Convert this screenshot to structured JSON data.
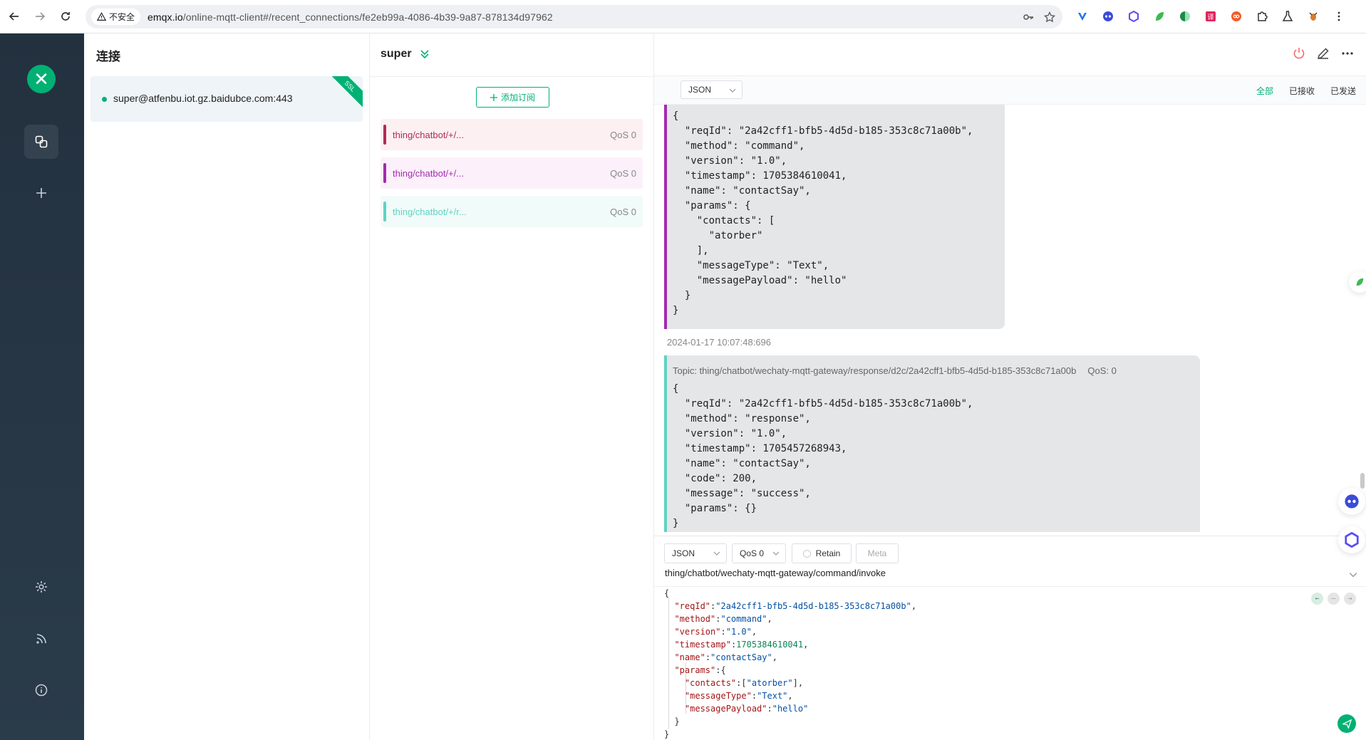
{
  "browser": {
    "insecure_label": "不安全",
    "url_host": "emqx.io",
    "url_path": "/online-mqtt-client#/recent_connections/fe2eb99a-4086-4b39-9a87-878134d97962",
    "extension_icons": [
      "vee-icon",
      "bot-face-icon",
      "hex-icon",
      "leaf-icon",
      "split-circle-icon",
      "translate-icon",
      "infinity-icon",
      "puzzle-icon",
      "flask-icon",
      "bug-icon",
      "menu-dots-icon"
    ]
  },
  "sidebar": {
    "logo_glyph": "✕",
    "items": [
      "connections-icon",
      "add-icon",
      "settings-icon",
      "feed-icon",
      "info-icon"
    ]
  },
  "connections": {
    "title": "连接",
    "items": [
      {
        "name": "super@atfenbu.iot.gz.baidubce.com:443",
        "badge": "SSL",
        "status_color": "#00b173"
      }
    ]
  },
  "subscriptions": {
    "connection_name": "super",
    "add_button": "添加订阅",
    "items": [
      {
        "topic": "thing/chatbot/+/...",
        "qos": "QoS 0",
        "color": "#b02b55",
        "bg": "#fcf0f3"
      },
      {
        "topic": "thing/chatbot/+/...",
        "qos": "QoS 0",
        "color": "#a32bb0",
        "bg": "#fcf0fa"
      },
      {
        "topic": "thing/chatbot/+/r...",
        "qos": "QoS 0",
        "color": "#5fd3c3",
        "bg": "#f1fbf9"
      }
    ]
  },
  "messages": {
    "format_select": "JSON",
    "tabs": [
      "全部",
      "已接收",
      "已发送"
    ],
    "active_tab": "全部",
    "list": [
      {
        "direction": "received",
        "border_color": "#a32bb0",
        "topic": "",
        "qos": "",
        "payload": "{\n  \"reqId\": \"2a42cff1-bfb5-4d5d-b185-353c8c71a00b\",\n  \"method\": \"command\",\n  \"version\": \"1.0\",\n  \"timestamp\": 1705384610041,\n  \"name\": \"contactSay\",\n  \"params\": {\n    \"contacts\": [\n      \"atorber\"\n    ],\n    \"messageType\": \"Text\",\n    \"messagePayload\": \"hello\"\n  }\n}",
        "time": "2024-01-17 10:07:48:696"
      },
      {
        "direction": "received",
        "border_color": "#5fd3c3",
        "topic": "Topic: thing/chatbot/wechaty-mqtt-gateway/response/d2c/2a42cff1-bfb5-4d5d-b185-353c8c71a00b",
        "qos": "QoS: 0",
        "payload": "{\n  \"reqId\": \"2a42cff1-bfb5-4d5d-b185-353c8c71a00b\",\n  \"method\": \"response\",\n  \"version\": \"1.0\",\n  \"timestamp\": 1705457268943,\n  \"name\": \"contactSay\",\n  \"code\": 200,\n  \"message\": \"success\",\n  \"params\": {}\n}",
        "time": ""
      }
    ]
  },
  "publish": {
    "format": "JSON",
    "qos": "QoS 0",
    "retain_label": "Retain",
    "meta_label": "Meta",
    "topic": "thing/chatbot/wechaty-mqtt-gateway/command/invoke",
    "payload_lines": [
      "{",
      "  \"reqId\":\"2a42cff1-bfb5-4d5d-b185-353c8c71a00b\",",
      "  \"method\":\"command\",",
      "  \"version\":\"1.0\",",
      "  \"timestamp\":1705384610041,",
      "  \"name\":\"contactSay\",",
      "  \"params\":{",
      "    \"contacts\":[\"atorber\"],",
      "    \"messageType\":\"Text\",",
      "    \"messagePayload\":\"hello\"",
      "  }",
      "}"
    ]
  },
  "colors": {
    "accent": "#00b173",
    "sidebar_bg": "#23313f"
  }
}
